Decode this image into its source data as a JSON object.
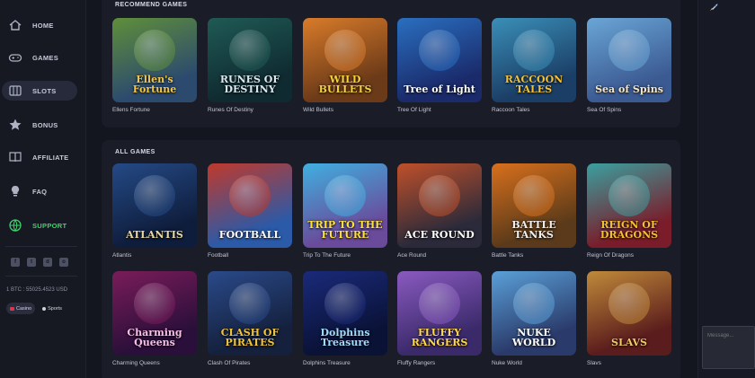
{
  "nav": {
    "items": [
      {
        "label": "HOME",
        "icon": "home-icon"
      },
      {
        "label": "GAMES",
        "icon": "gamepad-icon"
      },
      {
        "label": "SLOTS",
        "icon": "slots-icon"
      },
      {
        "label": "BONUS",
        "icon": "star-icon"
      },
      {
        "label": "AFFILIATE",
        "icon": "book-icon"
      },
      {
        "label": "FAQ",
        "icon": "lightbulb-icon"
      },
      {
        "label": "SUPPORT",
        "icon": "globe-icon"
      }
    ],
    "active": "SLOTS",
    "support_color": "#3fd46b"
  },
  "socials": [
    "facebook-icon",
    "twitter-icon",
    "discord-icon",
    "instagram-icon"
  ],
  "rate": "1 BTC : 55025.4523 USD",
  "mode_toggle": {
    "casino": "Casino",
    "sports": "Sports"
  },
  "sections": {
    "recommend": {
      "title": "RECOMMEND GAMES",
      "games": [
        {
          "name": "Ellens Fortune",
          "logo": "Ellen's Fortune",
          "bg": [
            "#5f8f3a",
            "#2c4a6e"
          ],
          "logo_color": "#f3c74a"
        },
        {
          "name": "Runes Of Destiny",
          "logo": "RUNES OF DESTINY",
          "bg": [
            "#1f5a55",
            "#0f2a30"
          ],
          "logo_color": "#d9e8f0"
        },
        {
          "name": "Wild Bullets",
          "logo": "WILD BULLETS",
          "bg": [
            "#d97b2a",
            "#6b3a18"
          ],
          "logo_color": "#f5d23c"
        },
        {
          "name": "Tree Of Light",
          "logo": "Tree of Light",
          "bg": [
            "#2a6fc0",
            "#1a2a6a"
          ],
          "logo_color": "#ffffff"
        },
        {
          "name": "Raccoon Tales",
          "logo": "RACCOON TALES",
          "bg": [
            "#3a8fb8",
            "#1b3e66"
          ],
          "logo_color": "#f2c23a"
        },
        {
          "name": "Sea Of Spins",
          "logo": "Sea of Spins",
          "bg": [
            "#6aa6d6",
            "#3b5a92"
          ],
          "logo_color": "#f6e6c4"
        }
      ]
    },
    "all": {
      "title": "ALL GAMES",
      "games": [
        {
          "name": "Atlantis",
          "logo": "ATLANTIS",
          "bg": [
            "#244a86",
            "#0f1d3c"
          ],
          "logo_color": "#e8d9a6"
        },
        {
          "name": "Football",
          "logo": "FOOTBALL",
          "bg": [
            "#c0392b",
            "#2a5aa8"
          ],
          "logo_color": "#ffffff"
        },
        {
          "name": "Trip To The Future",
          "logo": "TRIP TO THE FUTURE",
          "bg": [
            "#3fb0e0",
            "#6a4a9a"
          ],
          "logo_color": "#ffe23a"
        },
        {
          "name": "Ace Round",
          "logo": "ACE ROUND",
          "bg": [
            "#c0502a",
            "#2a2a3a"
          ],
          "logo_color": "#ffffff"
        },
        {
          "name": "Battle Tanks",
          "logo": "BATTLE TANKS",
          "bg": [
            "#d8701c",
            "#5a3a1a"
          ],
          "logo_color": "#f0f0f0"
        },
        {
          "name": "Reign Of Dragons",
          "logo": "REIGN OF DRAGONS",
          "bg": [
            "#3aa0a0",
            "#7a1c2a"
          ],
          "logo_color": "#f5c030"
        },
        {
          "name": "Charming Queens",
          "logo": "Charming Queens",
          "bg": [
            "#7a1c5a",
            "#2a0f3a"
          ],
          "logo_color": "#f6c0e6"
        },
        {
          "name": "Clash Of Pirates",
          "logo": "CLASH OF PIRATES",
          "bg": [
            "#2a4a8a",
            "#14203c"
          ],
          "logo_color": "#f2c43a"
        },
        {
          "name": "Dolphins Treasure",
          "logo": "Dolphins Treasure",
          "bg": [
            "#1a2a7a",
            "#0a1236"
          ],
          "logo_color": "#9fdcff"
        },
        {
          "name": "Fluffy Rangers",
          "logo": "FLUFFY RANGERS",
          "bg": [
            "#8a5ac0",
            "#3a2a6a"
          ],
          "logo_color": "#ffd84a"
        },
        {
          "name": "Nuke World",
          "logo": "NUKE WORLD",
          "bg": [
            "#5aa0d8",
            "#2a3a6a"
          ],
          "logo_color": "#ffffff"
        },
        {
          "name": "Slavs",
          "logo": "SLAVS",
          "bg": [
            "#c08a3a",
            "#5a1c1c"
          ],
          "logo_color": "#f2c86a"
        }
      ]
    }
  },
  "chat": {
    "placeholder": "Message..."
  },
  "right_rail_icon": "rocket-icon"
}
